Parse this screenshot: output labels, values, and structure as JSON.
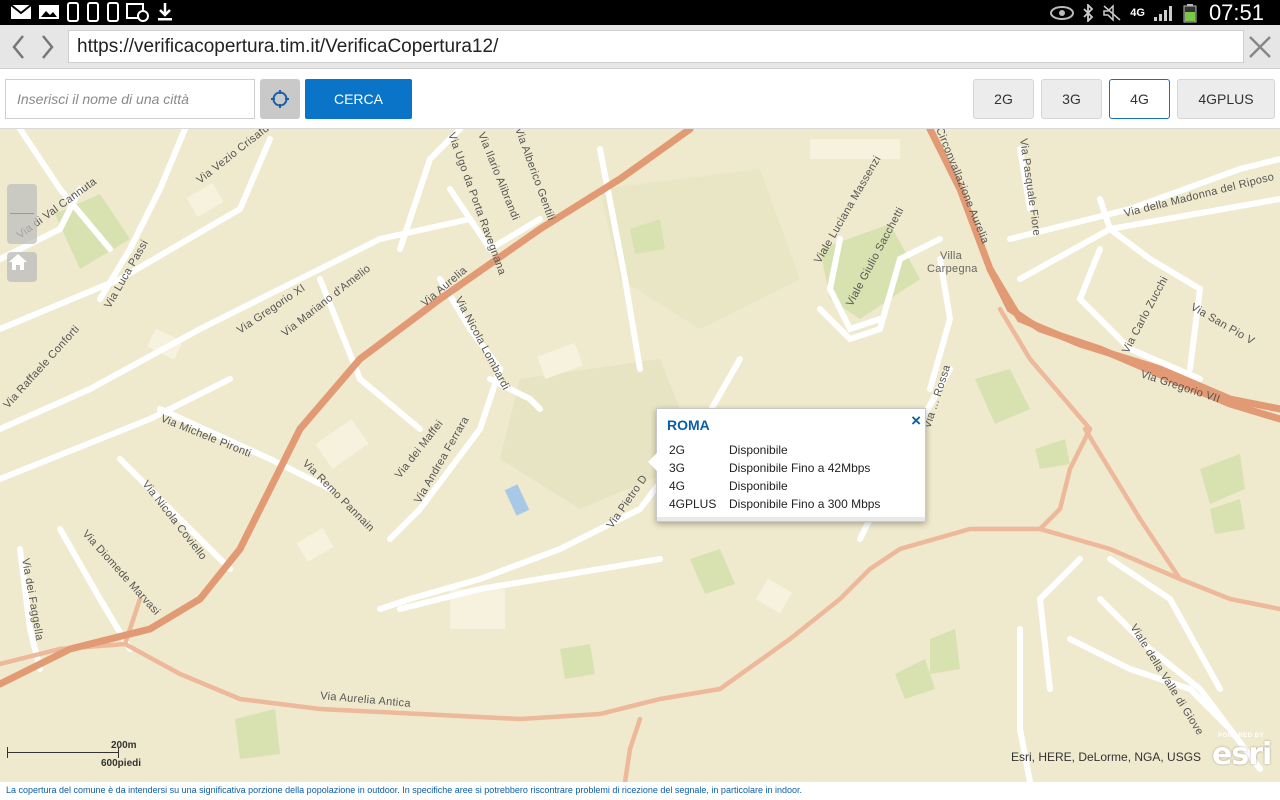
{
  "status_bar": {
    "time": "07:51",
    "network": "4G",
    "left_icons": [
      "mail-icon",
      "image-icon",
      "phone-icon",
      "phone-icon",
      "phone-icon",
      "calendar-clock-icon",
      "download-icon"
    ],
    "right_icons": [
      "eye-icon",
      "bluetooth-icon",
      "mute-icon",
      "4g-icon",
      "signal-icon",
      "battery-icon"
    ]
  },
  "browser": {
    "url": "https://verificacopertura.tim.it/VerificaCopertura12/"
  },
  "toolbar": {
    "city_placeholder": "Inserisci il nome di una città",
    "search_label": "CERCA",
    "networks": [
      "2G",
      "3G",
      "4G",
      "4GPLUS"
    ],
    "active_network": "4G"
  },
  "popup": {
    "title": "ROMA",
    "close": "×",
    "rows": [
      {
        "net": "2G",
        "status": "Disponibile"
      },
      {
        "net": "3G",
        "status": "Disponibile Fino a 42Mbps"
      },
      {
        "net": "4G",
        "status": "Disponibile"
      },
      {
        "net": "4GPLUS",
        "status": "Disponibile Fino a 300 Mbps"
      }
    ]
  },
  "map": {
    "scale_metric": "200m",
    "scale_imperial": "600piedi",
    "attribution": "Esri, HERE, DeLorme, NGA, USGS",
    "logo_small": "POWERED BY",
    "logo_text": "esri",
    "place_labels": [
      "Villa",
      "Carpegna"
    ],
    "street_labels": [
      "Via Vezio Crisafulli",
      "Via di Val Cannuta",
      "Via Luca Passi",
      "Via Gregorio XI",
      "Via Mariano d'Amelio",
      "Via Ugo da Porta Ravegnana",
      "Via Ilario Alibrandi",
      "Via Alberico Gentili",
      "Via Aurelia",
      "Via Nicola Lombardi",
      "Via Raffaele Conforti",
      "Via Michele Pironti",
      "Via dei Maffei",
      "Via Remo Pannain",
      "Via Andrea Ferrara",
      "Via Nicola Coviello",
      "Via Diomede Marvasi",
      "Via dei Faggella",
      "Via Aurelia Antica",
      "Via Pietro D",
      "Viale Luciana Massenzi",
      "Viale Giulio Sacchetti",
      "Circonvallazione Aurelia",
      "Via Pasquale Fiore",
      "Via della Madonna del Riposo",
      "Via Carlo Zucchi",
      "Via San Pio V",
      "Via Gregorio VII",
      "Viale della Valle di Giove",
      "Via ... Rossa"
    ]
  },
  "footer": {
    "text": "La copertura del comune è da intendersi su una significativa porzione della popolazione in outdoor. In specifiche aree si potrebbero riscontrare problemi di ricezione del segnale, in particolare in indoor."
  },
  "colors": {
    "brand_blue": "#0a74c9",
    "map_bg": "#efe9cd",
    "major_road": "#e29a74",
    "secondary_road": "#eeb89a",
    "park": "#d8e2b0"
  }
}
